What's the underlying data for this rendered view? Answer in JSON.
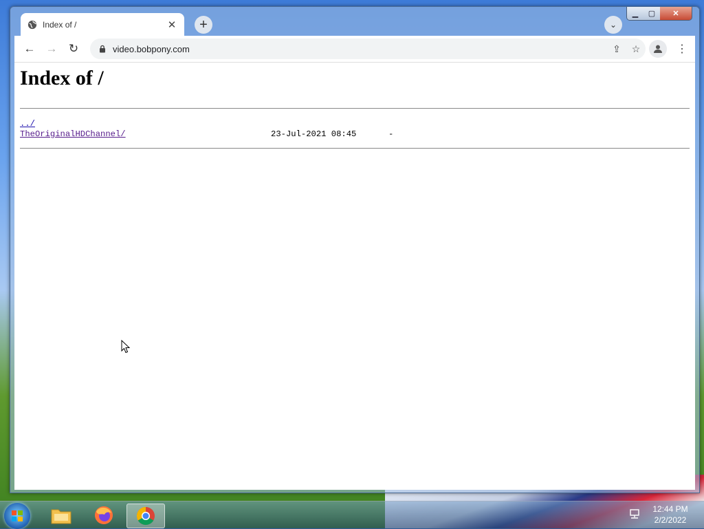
{
  "browser": {
    "tab": {
      "title": "Index of /",
      "close_glyph": "✕"
    },
    "new_tab_glyph": "+",
    "tab_search_glyph": "⌄",
    "address": {
      "url": "video.bobpony.com"
    },
    "window_controls": {
      "minimize": "▁",
      "maximize": "▢",
      "close": "✕"
    },
    "nav": {
      "back": "←",
      "forward": "→",
      "reload": "↻"
    },
    "omnibox_icons": {
      "share": "⇪",
      "bookmark": "☆"
    },
    "menu_glyph": "⋮"
  },
  "page": {
    "heading": "Index of /",
    "entries": [
      {
        "name": "../",
        "date": "",
        "size": ""
      },
      {
        "name": "TheOriginalHDChannel/",
        "date": "23-Jul-2021 08:45",
        "size": "-"
      }
    ]
  },
  "taskbar": {
    "apps": [
      "file-explorer-icon",
      "firefox-icon",
      "chrome-icon"
    ],
    "active_app": "chrome-icon",
    "clock": {
      "time": "12:44 PM",
      "date": "2/2/2022"
    }
  },
  "colors": {
    "link": "#1a0dab",
    "visited": "#551a8b",
    "close_button": "#c74a35"
  }
}
